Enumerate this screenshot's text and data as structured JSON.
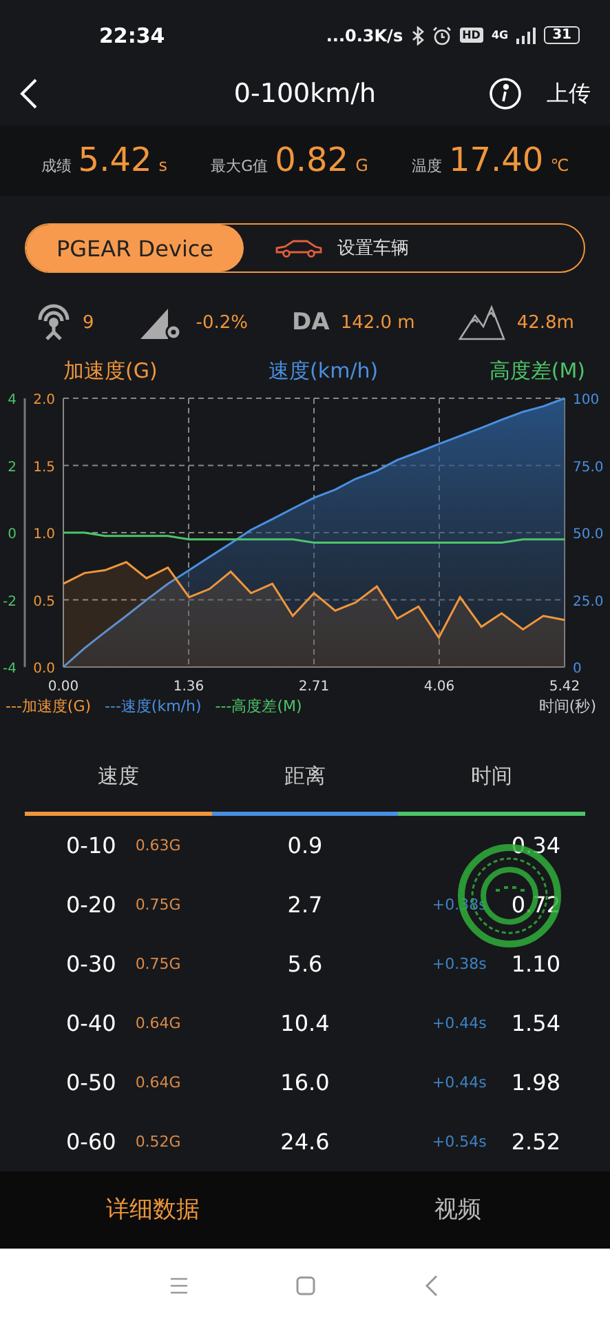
{
  "status_bar": {
    "time": "22:34",
    "network_speed": "...0.3K/s",
    "hd_badge": "HD",
    "network_type": "4G",
    "battery": "31"
  },
  "header": {
    "title": "0-100km/h",
    "action": "上传"
  },
  "summary": [
    {
      "label": "成绩",
      "value": "5.42",
      "unit": "s"
    },
    {
      "label": "最大G值",
      "value": "0.82",
      "unit": "G"
    },
    {
      "label": "温度",
      "value": "17.40",
      "unit": "℃"
    }
  ],
  "segments": [
    {
      "label": "PGEAR Device",
      "kind": "plain",
      "selected": true
    },
    {
      "label": "设置车辆",
      "kind": "vehicle",
      "selected": false
    }
  ],
  "indicators": [
    {
      "kind": "satellites",
      "value": "9"
    },
    {
      "kind": "slope",
      "value": "-0.2%"
    },
    {
      "kind": "density_altitude",
      "label": "DA",
      "value": "142.0 m"
    },
    {
      "kind": "elevation",
      "value": "42.8m"
    }
  ],
  "chart": {
    "legend": [
      "---加速度(G)",
      "---速度(km/h)",
      "---高度差(M)"
    ],
    "chart_data": {
      "type": "area",
      "grid": true,
      "xlabel": "时间(秒)",
      "xlim": [
        0,
        5.42
      ],
      "ylim": [
        0,
        2
      ],
      "y2lim": [
        0,
        100
      ],
      "y3lim": [
        -4,
        4
      ],
      "y2ticks": [
        {
          "value": 0,
          "label": "0"
        },
        {
          "value": 25,
          "label": "25.0"
        },
        {
          "value": 50,
          "label": "50.0"
        },
        {
          "value": 75,
          "label": "75.0"
        },
        {
          "value": 100,
          "label": "100"
        }
      ],
      "y3ticks": [
        -4,
        -2,
        0,
        2,
        4
      ],
      "yticks": [
        {
          "value": 0,
          "label": "0.0"
        },
        {
          "value": 0.5,
          "label": "0.5"
        },
        {
          "value": 1,
          "label": "1.0"
        },
        {
          "value": 1.5,
          "label": "1.5"
        },
        {
          "value": 2,
          "label": "2.0"
        }
      ],
      "xticks": [
        {
          "value": 0,
          "label": "0.00"
        },
        {
          "value": 1.355,
          "label": "1.36"
        },
        {
          "value": 2.71,
          "label": "2.71"
        },
        {
          "value": 4.065,
          "label": "4.06"
        },
        {
          "value": 5.42,
          "label": "5.42"
        }
      ],
      "x": [
        0,
        0.23,
        0.45,
        0.68,
        0.9,
        1.13,
        1.36,
        1.58,
        1.81,
        2.03,
        2.26,
        2.48,
        2.71,
        2.94,
        3.16,
        3.39,
        3.61,
        3.84,
        4.06,
        4.29,
        4.52,
        4.74,
        4.97,
        5.19,
        5.42
      ],
      "series": [
        {
          "name": "加速度(G)",
          "color": "#f0963c",
          "values": [
            0.62,
            0.7,
            0.72,
            0.78,
            0.66,
            0.74,
            0.52,
            0.58,
            0.71,
            0.55,
            0.62,
            0.38,
            0.55,
            0.42,
            0.48,
            0.6,
            0.36,
            0.45,
            0.22,
            0.52,
            0.3,
            0.4,
            0.28,
            0.38,
            0.35
          ]
        },
        {
          "name": "速度(km/h)",
          "color": "#4a90e2",
          "axis": "y2",
          "values": [
            0,
            7,
            13,
            19,
            25,
            31,
            36,
            41,
            46,
            51,
            55,
            59,
            63,
            66,
            70,
            73,
            77,
            80,
            83,
            86,
            89,
            92,
            95,
            97,
            100
          ]
        },
        {
          "name": "高度差(M)",
          "color": "#4cc56a",
          "axis": "y3",
          "type": "line",
          "values": [
            0,
            0,
            -0.1,
            -0.1,
            -0.1,
            -0.1,
            -0.2,
            -0.2,
            -0.2,
            -0.2,
            -0.2,
            -0.2,
            -0.3,
            -0.3,
            -0.3,
            -0.3,
            -0.3,
            -0.3,
            -0.3,
            -0.3,
            -0.3,
            -0.3,
            -0.2,
            -0.2,
            -0.2
          ]
        }
      ]
    }
  },
  "table": {
    "columns": [
      {
        "label": "速度",
        "color": "#f0963c"
      },
      {
        "label": "距离",
        "color": "#4a90e2"
      },
      {
        "label": "时间",
        "color": "#4cc56a"
      }
    ],
    "rows": [
      {
        "speed": "0-10",
        "g": "0.63G",
        "distance": "0.9",
        "time": "0.34"
      },
      {
        "speed": "0-20",
        "g": "0.75G",
        "distance": "2.7",
        "delta": "+0.38s",
        "time": "0.72"
      },
      {
        "speed": "0-30",
        "g": "0.75G",
        "distance": "5.6",
        "delta": "+0.38s",
        "time": "1.10"
      },
      {
        "speed": "0-40",
        "g": "0.64G",
        "distance": "10.4",
        "delta": "+0.44s",
        "time": "1.54"
      },
      {
        "speed": "0-50",
        "g": "0.64G",
        "distance": "16.0",
        "delta": "+0.44s",
        "time": "1.98"
      },
      {
        "speed": "0-60",
        "g": "0.52G",
        "distance": "24.6",
        "delta": "+0.54s",
        "time": "2.52"
      }
    ],
    "stamp": {
      "kind": "good"
    }
  },
  "bottom_tabs": [
    {
      "label": "详细数据",
      "selected": true
    },
    {
      "label": "视频",
      "selected": false
    }
  ]
}
